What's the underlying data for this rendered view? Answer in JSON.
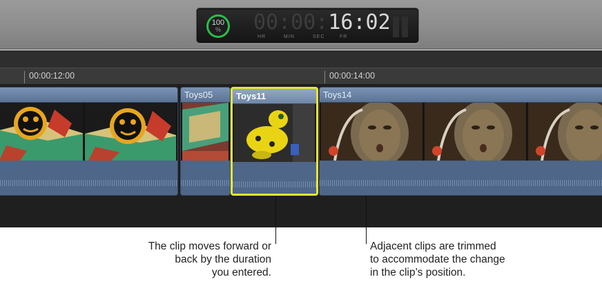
{
  "viewer": {
    "zoom_percent": "100",
    "zoom_sign": "%",
    "timecode_dim": "00:00:",
    "timecode_lit": "16:02",
    "unit_labels": [
      "HR",
      "MIN",
      "SEC",
      "FR"
    ],
    "ring_color": "#27c04a"
  },
  "ruler": {
    "marks": [
      "00:00:12:00",
      "00:00:14:00"
    ]
  },
  "clips": [
    {
      "title": "",
      "selected": false
    },
    {
      "title": "Toys05",
      "selected": false
    },
    {
      "title": "Toys11",
      "selected": true
    },
    {
      "title": "Toys14",
      "selected": false
    }
  ],
  "callouts": {
    "left": [
      "The clip moves forward or",
      "back by the duration",
      "you entered."
    ],
    "right": [
      "Adjacent clips are trimmed",
      "to accommodate the change",
      "in the clip’s position."
    ]
  },
  "colors": {
    "clip_blue": "#5f7798",
    "selection_yellow": "#e9e438"
  }
}
